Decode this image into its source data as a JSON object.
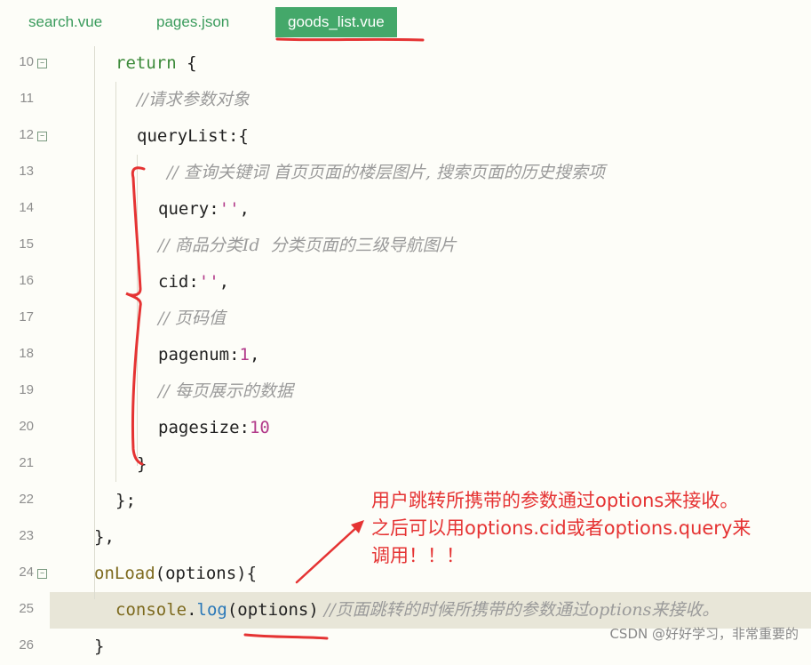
{
  "tabs": [
    {
      "label": "search.vue"
    },
    {
      "label": "pages.json"
    },
    {
      "label": "goods_list.vue"
    }
  ],
  "lines": [
    {
      "num": "10",
      "fold": true
    },
    {
      "num": "11",
      "fold": false
    },
    {
      "num": "12",
      "fold": true
    },
    {
      "num": "13",
      "fold": false
    },
    {
      "num": "14",
      "fold": false
    },
    {
      "num": "15",
      "fold": false
    },
    {
      "num": "16",
      "fold": false
    },
    {
      "num": "17",
      "fold": false
    },
    {
      "num": "18",
      "fold": false
    },
    {
      "num": "19",
      "fold": false
    },
    {
      "num": "20",
      "fold": false
    },
    {
      "num": "21",
      "fold": false
    },
    {
      "num": "22",
      "fold": false
    },
    {
      "num": "23",
      "fold": false
    },
    {
      "num": "24",
      "fold": true
    },
    {
      "num": "25",
      "fold": false
    },
    {
      "num": "26",
      "fold": false
    }
  ],
  "code": {
    "l10_kw": "return",
    "l10_rest": " {",
    "l11_cmt": "//请求参数对象",
    "l12": "queryList:{",
    "l13_cmt": "// 查询关键词 首页页面的楼层图片, 搜索页面的历史搜索项",
    "l14_key": "query:",
    "l14_str": "''",
    "l14_end": ",",
    "l15_cmt": "// 商品分类Id  分类页面的三级导航图片",
    "l16_key": "cid:",
    "l16_str": "''",
    "l16_end": ",",
    "l17_cmt": "// 页码值",
    "l18_key": "pagenum:",
    "l18_num": "1",
    "l18_end": ",",
    "l19_cmt": "// 每页展示的数据",
    "l20_key": "pagesize:",
    "l20_num": "10",
    "l21": "}",
    "l22": "};",
    "l23": "},",
    "l24_fn": "onLoad",
    "l24_rest": "(options){",
    "l25_obj": "console",
    "l25_dot": ".",
    "l25_meth": "log",
    "l25_args": "(options)",
    "l25_cmt": " //页面跳转的时候所携带的参数通过options来接收。",
    "l26": "}"
  },
  "annotation": {
    "line1": "用户跳转所携带的参数通过options来接收。",
    "line2": "之后可以用options.cid或者options.query来",
    "line3": "调用！！！"
  },
  "watermark": "CSDN @好好学习，非常重要的",
  "colors": {
    "annotation": "#e53333",
    "tab_active": "#44a86a",
    "keyword": "#3c8a3a"
  }
}
